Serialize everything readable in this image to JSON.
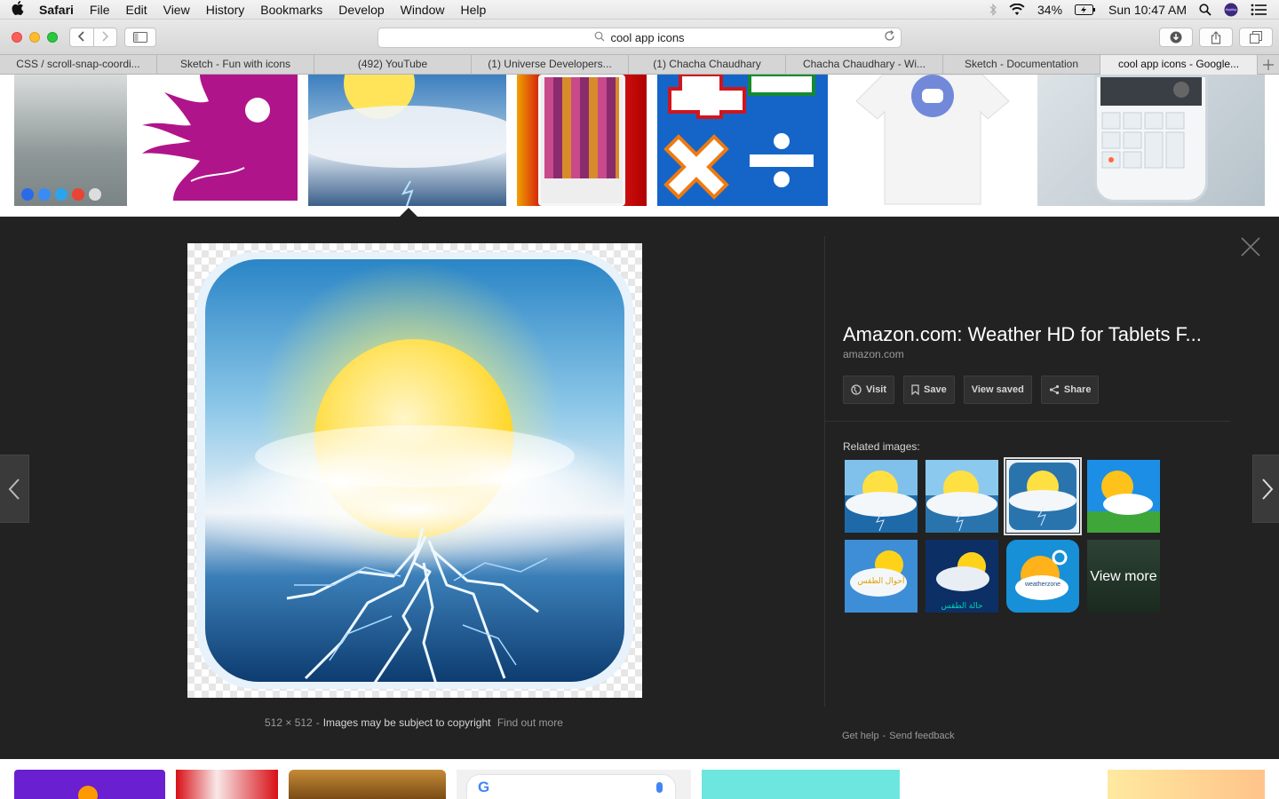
{
  "menubar": {
    "app_name": "Safari",
    "items": [
      "File",
      "Edit",
      "View",
      "History",
      "Bookmarks",
      "Develop",
      "Window",
      "Help"
    ],
    "battery": "34%",
    "clock": "Sun 10:47 AM"
  },
  "toolbar": {
    "url_text": "cool app icons"
  },
  "tabs": [
    {
      "label": "CSS / scroll-snap-coordi..."
    },
    {
      "label": "Sketch - Fun with icons"
    },
    {
      "label": "(492) YouTube"
    },
    {
      "label": "(1) Universe Developers..."
    },
    {
      "label": "(1) Chacha Chaudhary"
    },
    {
      "label": "Chacha Chaudhary - Wi..."
    },
    {
      "label": "Sketch - Documentation"
    },
    {
      "label": "cool app icons - Google..."
    }
  ],
  "preview": {
    "dimensions": "512 × 512",
    "copyright_text": "Images may be subject to copyright",
    "find_out_more": "Find out more"
  },
  "info": {
    "title": "Amazon.com: Weather HD for Tablets F...",
    "domain": "amazon.com",
    "actions": {
      "visit": "Visit",
      "save": "Save",
      "view_saved": "View saved",
      "share": "Share"
    },
    "related_label": "Related images:",
    "view_more": "View more",
    "related_tile_6_text": "حالة الطقس",
    "related_tile_5_text": "أحوال الطقس",
    "related_tile_7_text": "weatherzone"
  },
  "footer": {
    "get_help": "Get help",
    "send_feedback": "Send feedback",
    "separator": "-"
  },
  "colors": {
    "panel_bg": "#222222",
    "accent_blue": "#1565c8"
  }
}
